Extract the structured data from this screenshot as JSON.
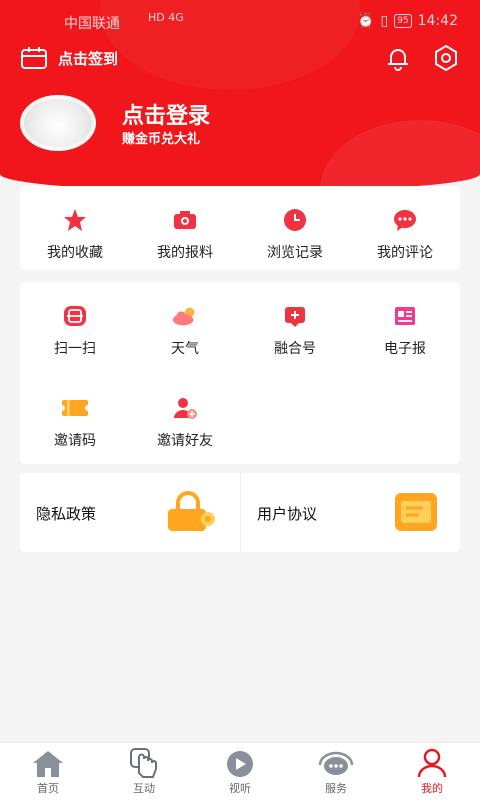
{
  "status_bar": {
    "carrier": "中国联通",
    "network": "HD 4G",
    "battery": "95",
    "time": "14:42"
  },
  "top_bar": {
    "sign_in_label": "点击签到"
  },
  "profile": {
    "login_title": "点击登录",
    "login_subtitle": "赚金币兑大礼"
  },
  "quick_actions": [
    {
      "label": "我的收藏",
      "icon": "star-icon"
    },
    {
      "label": "我的报料",
      "icon": "camera-icon"
    },
    {
      "label": "浏览记录",
      "icon": "clock-icon"
    },
    {
      "label": "我的评论",
      "icon": "comment-icon"
    }
  ],
  "tools": [
    {
      "label": "扫一扫",
      "icon": "scan-icon"
    },
    {
      "label": "天气",
      "icon": "cloud-icon"
    },
    {
      "label": "融合号",
      "icon": "media-account-icon"
    },
    {
      "label": "电子报",
      "icon": "newspaper-icon"
    },
    {
      "label": "邀请码",
      "icon": "ticket-icon"
    },
    {
      "label": "邀请好友",
      "icon": "add-friend-icon"
    }
  ],
  "policies": {
    "privacy": "隐私政策",
    "agreement": "用户协议"
  },
  "tab_bar": {
    "items": [
      {
        "label": "首页",
        "icon": "home-icon"
      },
      {
        "label": "互动",
        "icon": "tap-icon"
      },
      {
        "label": "视听",
        "icon": "play-icon"
      },
      {
        "label": "服务",
        "icon": "chat-icon"
      },
      {
        "label": "我的",
        "icon": "person-icon"
      }
    ],
    "active_index": 4
  },
  "colors": {
    "brand_red": "#f0161c",
    "active_tab": "#e81a21",
    "background": "#f4f4f4"
  }
}
